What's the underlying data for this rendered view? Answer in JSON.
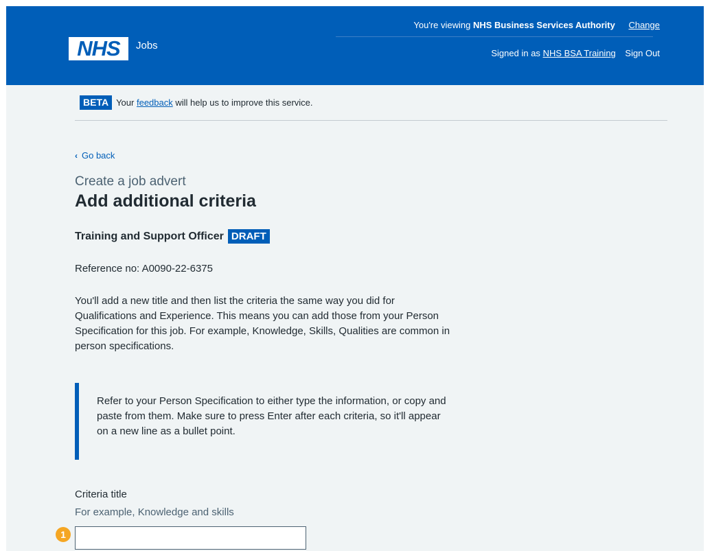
{
  "header": {
    "logo": "NHS",
    "service": "Jobs",
    "viewing_prefix": "You're viewing",
    "organisation": "NHS Business Services Authority",
    "change_link": "Change",
    "signed_in_prefix": "Signed in as",
    "user": "NHS BSA Training",
    "sign_out": "Sign Out"
  },
  "beta": {
    "tag": "BETA",
    "text_before": "Your",
    "link": "feedback",
    "text_after": "will help us to improve this service."
  },
  "nav": {
    "back": "Go back"
  },
  "page": {
    "caption": "Create a job advert",
    "title": "Add additional criteria",
    "job_title": "Training and Support Officer",
    "status": "DRAFT",
    "reference": "Reference no: A0090-22-6375",
    "intro": "You'll add a new title and then list the criteria the same way you did for Qualifications and Experience. This means you can add those from your Person Specification for this job. For example, Knowledge, Skills, Qualities are common in person specifications.",
    "inset": "Refer to your Person Specification to either type the information, or copy and paste from them. Make sure to press Enter after each criteria, so it'll appear on a new line as a bullet point."
  },
  "form": {
    "label": "Criteria title",
    "hint": "For example, Knowledge and skills",
    "value": "",
    "marker": "1"
  },
  "colors": {
    "brand": "#005eb8",
    "marker": "#f5a623",
    "background": "#f0f4f5"
  }
}
